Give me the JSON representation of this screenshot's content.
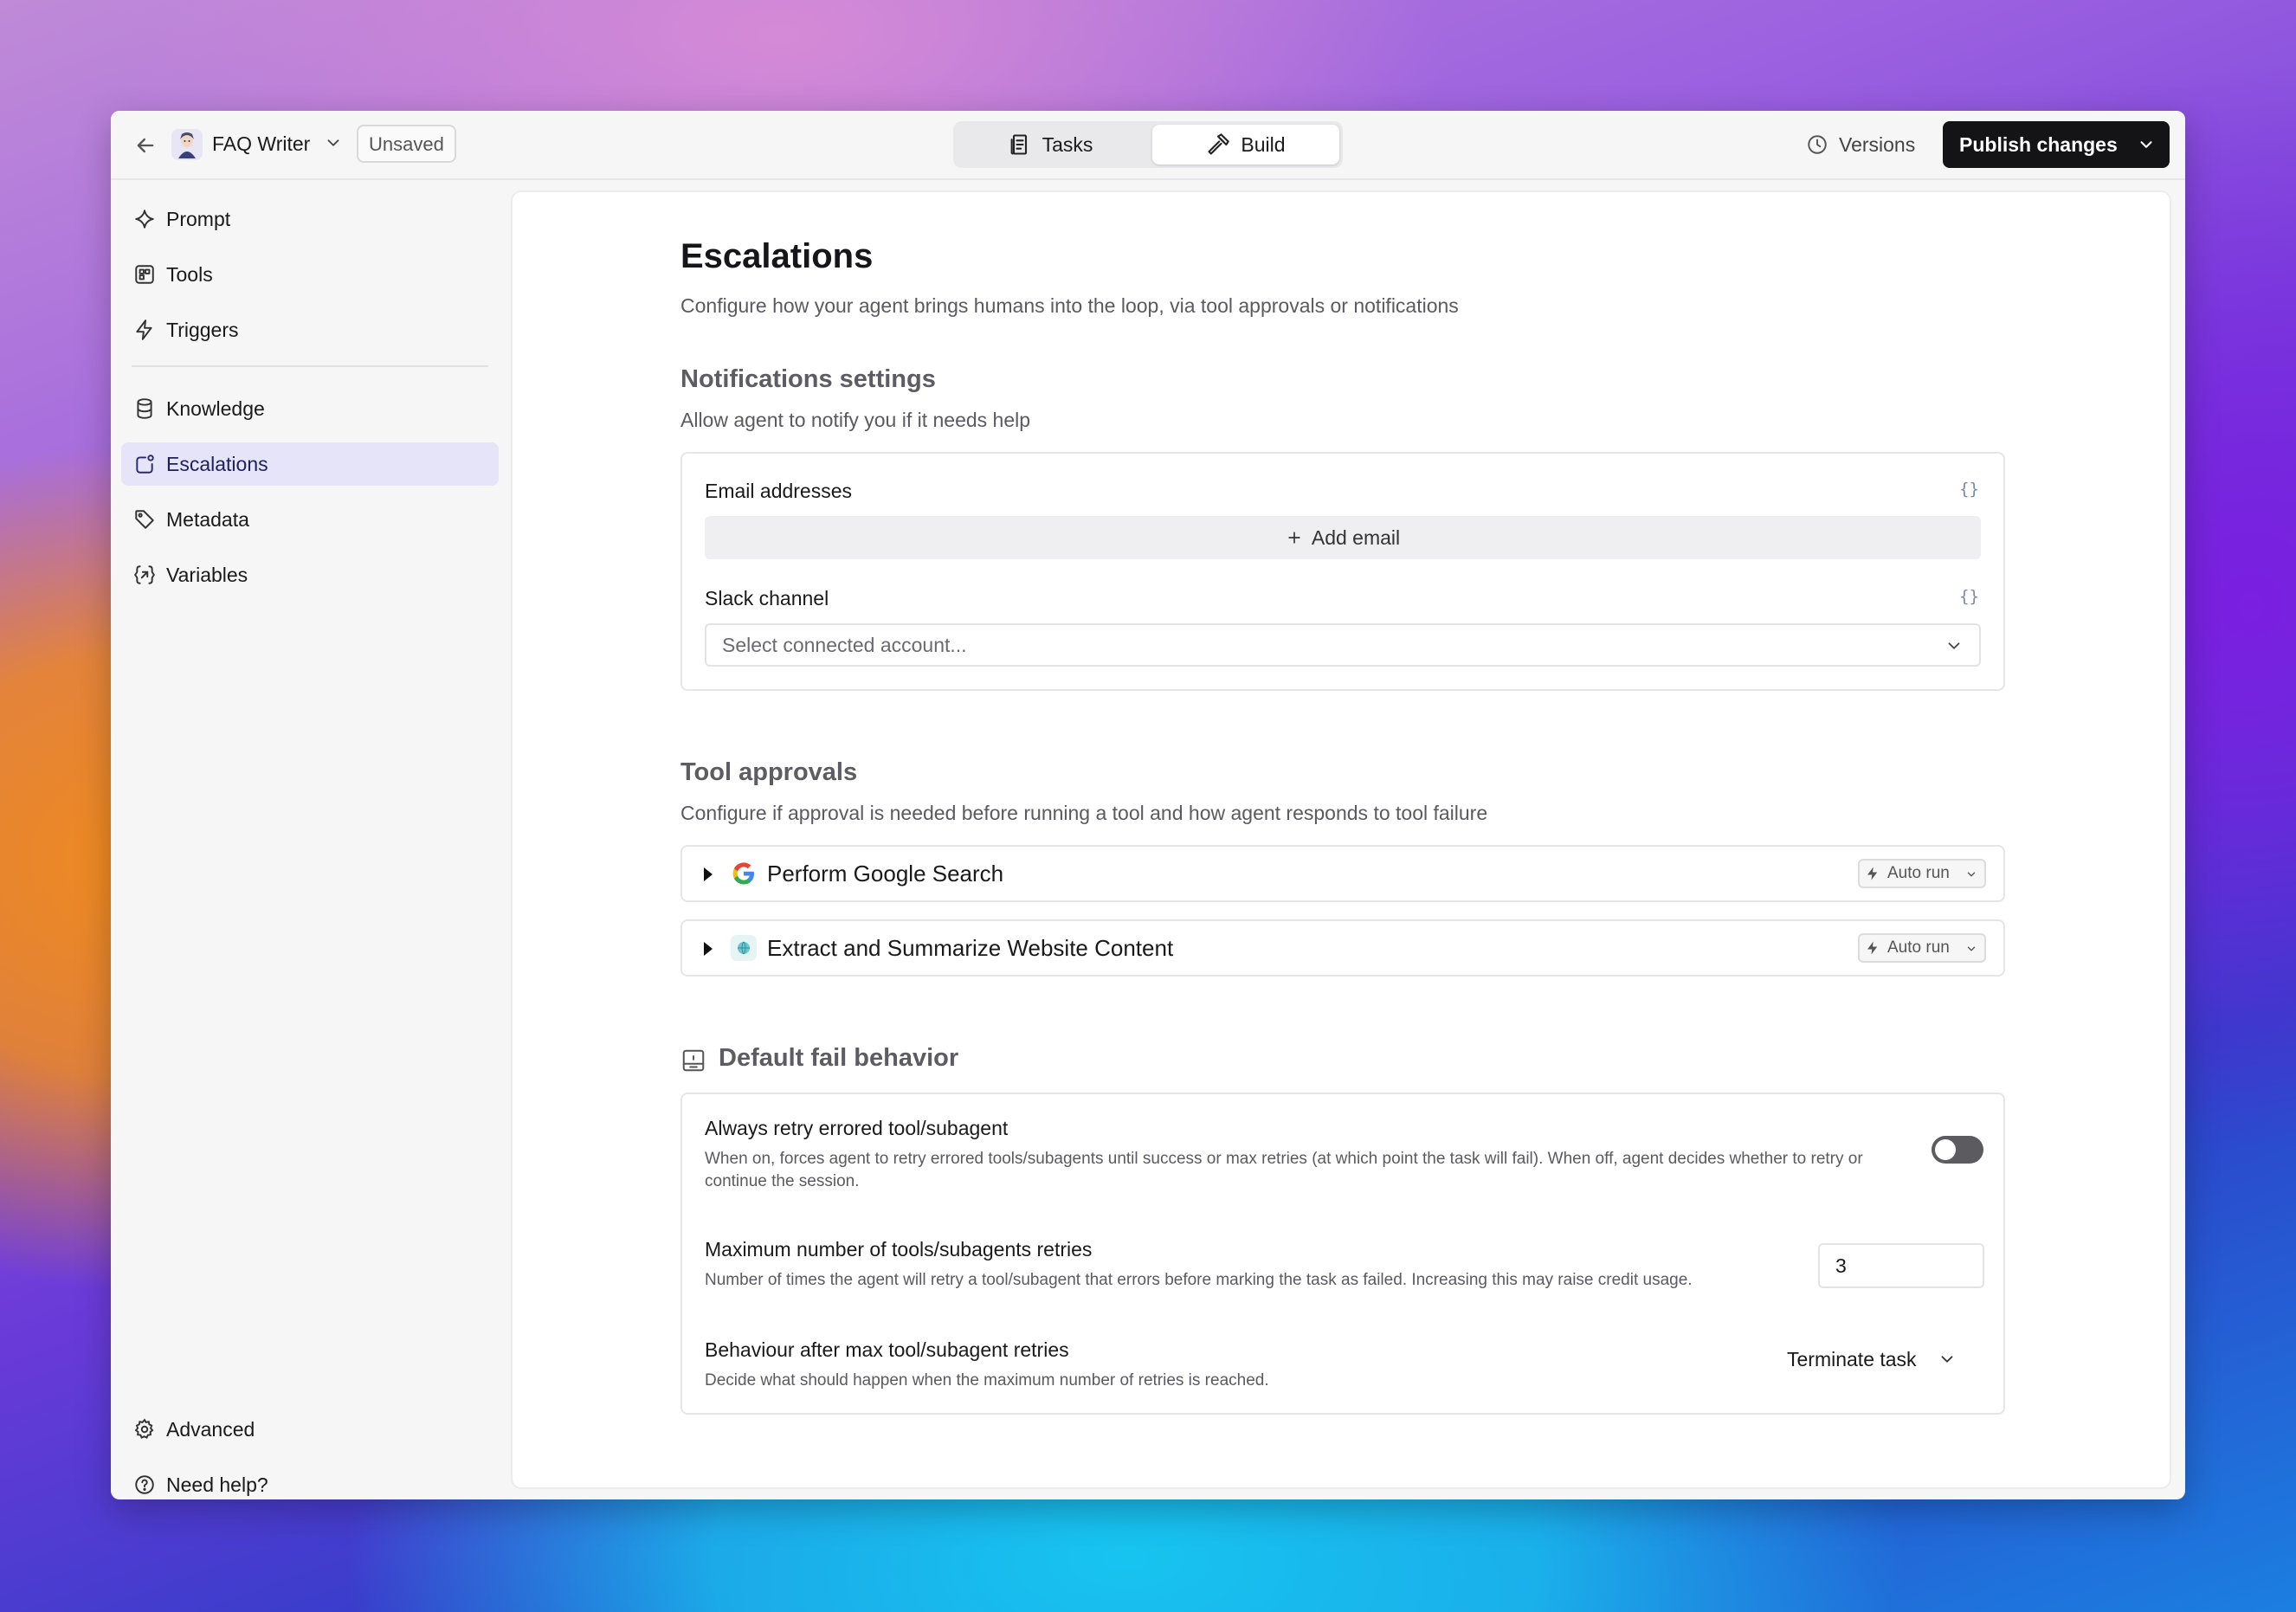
{
  "header": {
    "agent_name": "FAQ Writer",
    "unsaved_label": "Unsaved",
    "tabs": [
      {
        "label": "Tasks",
        "icon": "tasks-icon",
        "active": false
      },
      {
        "label": "Build",
        "icon": "hammer-icon",
        "active": true
      }
    ],
    "versions_label": "Versions",
    "publish_label": "Publish changes"
  },
  "sidebar": {
    "items": [
      {
        "label": "Prompt",
        "icon": "sparkle-icon"
      },
      {
        "label": "Tools",
        "icon": "tools-icon"
      },
      {
        "label": "Triggers",
        "icon": "bolt-icon"
      },
      {
        "label": "Knowledge",
        "icon": "database-icon"
      },
      {
        "label": "Escalations",
        "icon": "escalation-icon",
        "active": true
      },
      {
        "label": "Metadata",
        "icon": "tag-icon"
      },
      {
        "label": "Variables",
        "icon": "variable-icon"
      }
    ],
    "bottom_items": [
      {
        "label": "Advanced",
        "icon": "gear-icon"
      },
      {
        "label": "Need help?",
        "icon": "help-icon"
      }
    ],
    "active_color": "#e6e4f8"
  },
  "page": {
    "title": "Escalations",
    "subtitle": "Configure how your agent brings humans into the loop, via tool approvals or notifications"
  },
  "notifications": {
    "title": "Notifications settings",
    "subtitle": "Allow agent to notify you if it needs help",
    "email_label": "Email addresses",
    "braces": "{}",
    "add_email_label": "Add email",
    "slack_label": "Slack channel",
    "slack_placeholder": "Select connected account..."
  },
  "tool_approvals": {
    "title": "Tool approvals",
    "subtitle": "Configure if approval is needed before running a tool and how agent responds to tool failure",
    "tools": [
      {
        "name": "Perform Google Search",
        "icon": "google-icon",
        "mode": "Auto run"
      },
      {
        "name": "Extract and Summarize Website Content",
        "icon": "globe-icon",
        "mode": "Auto run"
      }
    ]
  },
  "fail_behavior": {
    "title": "Default fail behavior",
    "retry_title": "Always retry errored tool/subagent",
    "retry_desc": "When on, forces agent to retry errored tools/subagents until success or max retries (at which point the task will fail). When off, agent decides whether to retry or continue the session.",
    "retry_enabled": false,
    "max_title": "Maximum number of tools/subagents retries",
    "max_desc": "Number of times the agent will retry a tool/subagent that errors before marking the task as failed. Increasing this may raise credit usage.",
    "max_value": "3",
    "after_title": "Behaviour after max tool/subagent retries",
    "after_desc": "Decide what should happen when the maximum number of retries is reached.",
    "after_value": "Terminate task"
  },
  "colors": {
    "publish_bg": "#141416",
    "toggle_off": "#5b5b60"
  }
}
